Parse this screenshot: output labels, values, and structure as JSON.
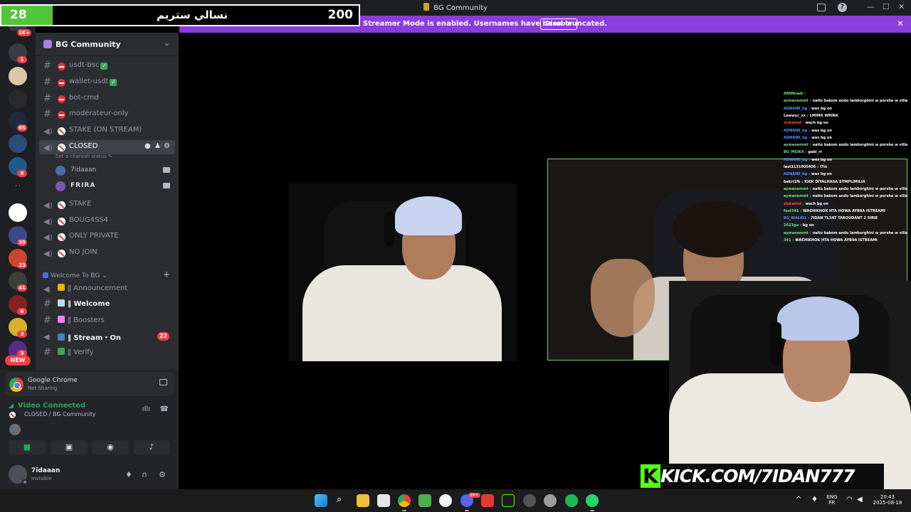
{
  "window": {
    "title": "BG Community",
    "controls": {
      "minimize": "—",
      "maximize": "☐",
      "close": "✕"
    }
  },
  "banner": {
    "text": "Streamer Mode is enabled. Usernames have been truncated.",
    "button": "Disable",
    "close": "✕"
  },
  "overlay": {
    "left_number": "28",
    "arabic_text": "نسالي ستريم",
    "right_number": "200"
  },
  "servers": {
    "badges": [
      "1K+",
      "1",
      "65",
      "9",
      "39",
      "23",
      "41",
      "6",
      "3",
      "3",
      "3"
    ],
    "new_label": "NEW"
  },
  "guild": {
    "name": "BG Community",
    "chevron": "⌄"
  },
  "channels": {
    "locked_text": [
      {
        "name": "usdt-bsc",
        "check": true
      },
      {
        "name": "wallet-usdt",
        "check": true
      },
      {
        "name": "bot-cmd",
        "check": false
      },
      {
        "name": "modérateur-only",
        "check": false
      }
    ],
    "stake_on_stream": "STAKE (ON STREAM)",
    "closed": "CLOSED",
    "closed_status": "Set a channel status",
    "voice_users": [
      "7idaaan",
      "FRIRA"
    ],
    "voice_more": [
      "STAKE",
      "BOUG4SS4",
      "ONLY PRIVATE",
      "NO JOIN"
    ],
    "category": "Welcome To BG",
    "welcome_channels": [
      {
        "name": "Announcement",
        "prefix": "‖",
        "bold": false
      },
      {
        "name": "Welcome",
        "prefix": "‖",
        "bold": true
      },
      {
        "name": "Boosters",
        "prefix": "‖",
        "bold": false
      },
      {
        "name": "Stream・On",
        "prefix": "‖",
        "bold": true,
        "badge": "22"
      },
      {
        "name": "Verify",
        "prefix": "‖",
        "bold": false
      }
    ]
  },
  "panel": {
    "share_app": "Google Chrome",
    "share_status": "Not Sharing",
    "voice_title": "Video Connected",
    "voice_sub": "CLOSED / BG Community",
    "user_name": "7idaaan",
    "user_status": "Invisible"
  },
  "chat": [
    {
      "user": "AMINnadi :",
      "msg": "",
      "color": "#7de07d"
    },
    {
      "user": "aymanemmt :",
      "msg": "naito bakom ando lamborghini w porshe w villa",
      "color": "#7de07d"
    },
    {
      "user": "ADNANE_bg :",
      "msg": "wax bg on",
      "color": "#5a8cff"
    },
    {
      "user": "Lawwyc_xx :",
      "msg": "LMIMA WRINA",
      "color": "#ffffff"
    },
    {
      "user": "zlokwind :",
      "msg": "wach bg on",
      "color": "#ff4a4a"
    },
    {
      "user": "ADNANE_bg :",
      "msg": "wax bg on",
      "color": "#5a8cff"
    },
    {
      "user": "ADNANE_bg :",
      "msg": "wax bg on",
      "color": "#5a8cff"
    },
    {
      "user": "aymanemmt :",
      "msg": "naito bakom ando lamborghini w porshe w villa",
      "color": "#7de07d"
    },
    {
      "user": "BG_MSIKA :",
      "msg": "gabi_rr",
      "color": "#7de07d"
    },
    {
      "user": "ADNANE_bg :",
      "msg": "wax bg on",
      "color": "#5a8cff"
    },
    {
      "user": "last1131005406 :",
      "msg": "l7lo",
      "color": "#ffffff"
    },
    {
      "user": "ADNANE_bg :",
      "msg": "wax bg on",
      "color": "#5a8cff"
    },
    {
      "user": "bekri1fk :",
      "msg": "KICK DIYALHAAA SYMPLIMILIA",
      "color": "#ffffff"
    },
    {
      "user": "aymanemmt :",
      "msg": "naito bakom ando lamborghini w porshe w villa",
      "color": "#7de07d"
    },
    {
      "user": "aymanemmt :",
      "msg": "naito bakom ando lamborghini w porshe w villa",
      "color": "#7de07d"
    },
    {
      "user": "zlokwind :",
      "msg": "wach bg on",
      "color": "#ff4a4a"
    },
    {
      "user": "fost341 :",
      "msg": "WACHIKHOK HTA HOWA AYB9A ISTREAMI",
      "color": "#7de07d"
    },
    {
      "user": "BG_WALID1 :",
      "msg": "7IDAN TL3AT TAROUDANT 2 SIRIE",
      "color": "#5a8cff"
    },
    {
      "user": "2023gu :",
      "msg": "bg on",
      "color": "#7de07d"
    },
    {
      "user": "aymanemmt :",
      "msg": "naito bakom ando lamborghini w porshe w villa",
      "color": "#7de07d"
    },
    {
      "user": "341 :",
      "msg": "WACHIKHOK HTA HOWA AYB9A ISTREAMI",
      "color": "#7de07d"
    }
  ],
  "kick": {
    "k": "K",
    "text": "KICK.COM/7IDAN777"
  },
  "taskbar": {
    "lang_top": "ENG",
    "lang_bottom": "FR",
    "time": "20:43",
    "date": "2025-08-18",
    "notif_badge": "99+",
    "chevron": "^"
  },
  "colors": {
    "banner": "#8b3cdb",
    "voice_connected": "#23a55a",
    "kick_green": "#53fc18",
    "badge_red": "#f23f42"
  }
}
